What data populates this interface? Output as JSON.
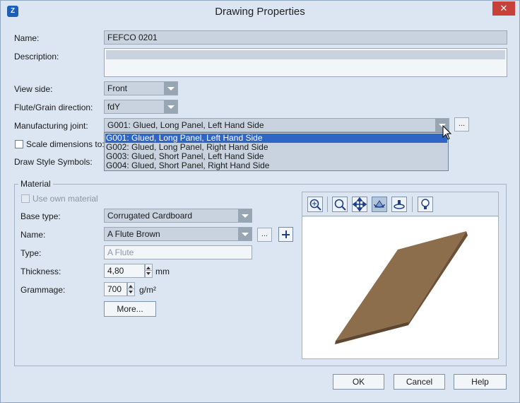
{
  "window": {
    "title": "Drawing Properties",
    "close_glyph": "✕",
    "app_icon": "app-logo-icon"
  },
  "form": {
    "name_label": "Name:",
    "name_value": "FEFCO 0201",
    "description_label": "Description:",
    "description_value": "",
    "view_side_label": "View side:",
    "view_side_value": "Front",
    "flute_label": "Flute/Grain direction:",
    "flute_value": "fdY",
    "joint_label": "Manufacturing joint:",
    "joint_value": "G001: Glued, Long Panel, Left Hand Side",
    "joint_more": "...",
    "joint_options": [
      "G001: Glued, Long Panel, Left Hand Side",
      "G002: Glued, Long Panel, Right Hand Side",
      "G003: Glued, Short Panel, Left Hand Side",
      "G004: Glued, Short Panel, Right Hand Side"
    ],
    "scale_label": "Scale dimensions to:",
    "draw_style_label": "Draw Style Symbols:"
  },
  "material": {
    "group_title": "Material",
    "use_own_label": "Use own material",
    "base_type_label": "Base type:",
    "base_type_value": "Corrugated Cardboard",
    "name_label": "Name:",
    "name_value": "A Flute Brown",
    "name_more": "...",
    "type_label": "Type:",
    "type_value": "A Flute",
    "thickness_label": "Thickness:",
    "thickness_value": "4,80",
    "thickness_unit": "mm",
    "grammage_label": "Grammage:",
    "grammage_value": "700",
    "grammage_unit": "g/m²",
    "more_button": "More..."
  },
  "preview": {
    "tools": [
      "zoom-fit-icon",
      "zoom-icon",
      "pan-icon",
      "rotate-icon",
      "orbit-icon",
      "light-bulb-icon"
    ],
    "board_colors": {
      "top": "#8c6d4c",
      "left_edge": "#6b5137",
      "bottom_edge": "#5f472f"
    }
  },
  "buttons": {
    "ok": "OK",
    "cancel": "Cancel",
    "help": "Help"
  },
  "colors": {
    "window_bg": "#dbe6f2",
    "selection": "#2f66c6",
    "close": "#c7413a"
  }
}
